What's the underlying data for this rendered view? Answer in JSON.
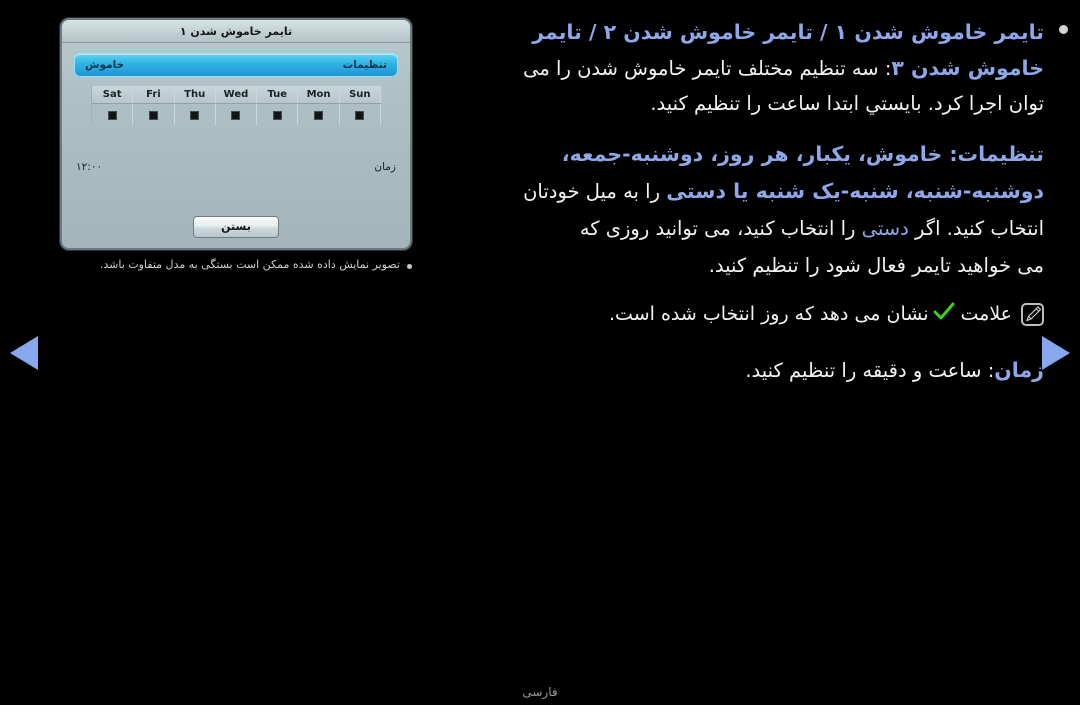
{
  "dialog": {
    "title": "تایمر خاموش شدن ۱",
    "selected_row": {
      "label": "تنظیمات",
      "value": "خاموش"
    },
    "days": [
      {
        "abbr": "Sat",
        "checked": false
      },
      {
        "abbr": "Fri",
        "checked": false
      },
      {
        "abbr": "Thu",
        "checked": false
      },
      {
        "abbr": "Wed",
        "checked": false
      },
      {
        "abbr": "Tue",
        "checked": false
      },
      {
        "abbr": "Mon",
        "checked": false
      },
      {
        "abbr": "Sun",
        "checked": false
      }
    ],
    "time": {
      "label": "زمان",
      "value": "۱۲:۰۰"
    },
    "close_button": "بستن"
  },
  "caption": {
    "text": "تصویر نمایش داده شده ممکن است بستگی به مدل متفاوت باشد."
  },
  "content": {
    "paragraph1": {
      "line1_blue": "تایمر خاموش شدن ۱ / تایمر خاموش شدن ۲ / تایمر",
      "line2_blue": "خاموش شدن ۳",
      "line2_white": ": سه تنظیم مختلف تایمر خاموش شدن را می",
      "line3_white": "توان اجرا کرد. بایستي ابتدا ساعت را تنظیم کنید."
    },
    "paragraph2": {
      "line1_blue": "تنظیمات: خاموش، یکبار، هر روز، دوشنبه-جمعه،",
      "line2_blue": "دوشنبه-شنبه، شنبه-یک شنبه یا دستی",
      "line2_white": " را به میل خودتان",
      "line3_white_a": "انتخاب کنید. اگر ",
      "line3_blue": "دستی",
      "line3_white_b": " را انتخاب کنید، می توانید روزی که",
      "line4_white": "می خواهید تایمر فعال شود را تنظیم کنید."
    },
    "note": {
      "text_before": "علامت",
      "tick": "✔",
      "text_after": "نشان می دهد که روز انتخاب شده است."
    },
    "paragraph3": {
      "line1_blue": "زمان",
      "line1_white": ": ساعت و دقیقه را تنظیم کنید."
    }
  },
  "nav": {
    "prev_label": "صفحه قبل",
    "next_label": "صفحه بعد"
  },
  "footer": {
    "language": "فارسی"
  },
  "colors": {
    "accent_blue": "#8ea7e8",
    "nav_blue": "#87a8ef",
    "tick_green": "#3dd018",
    "body_white": "#f2f2f2"
  }
}
